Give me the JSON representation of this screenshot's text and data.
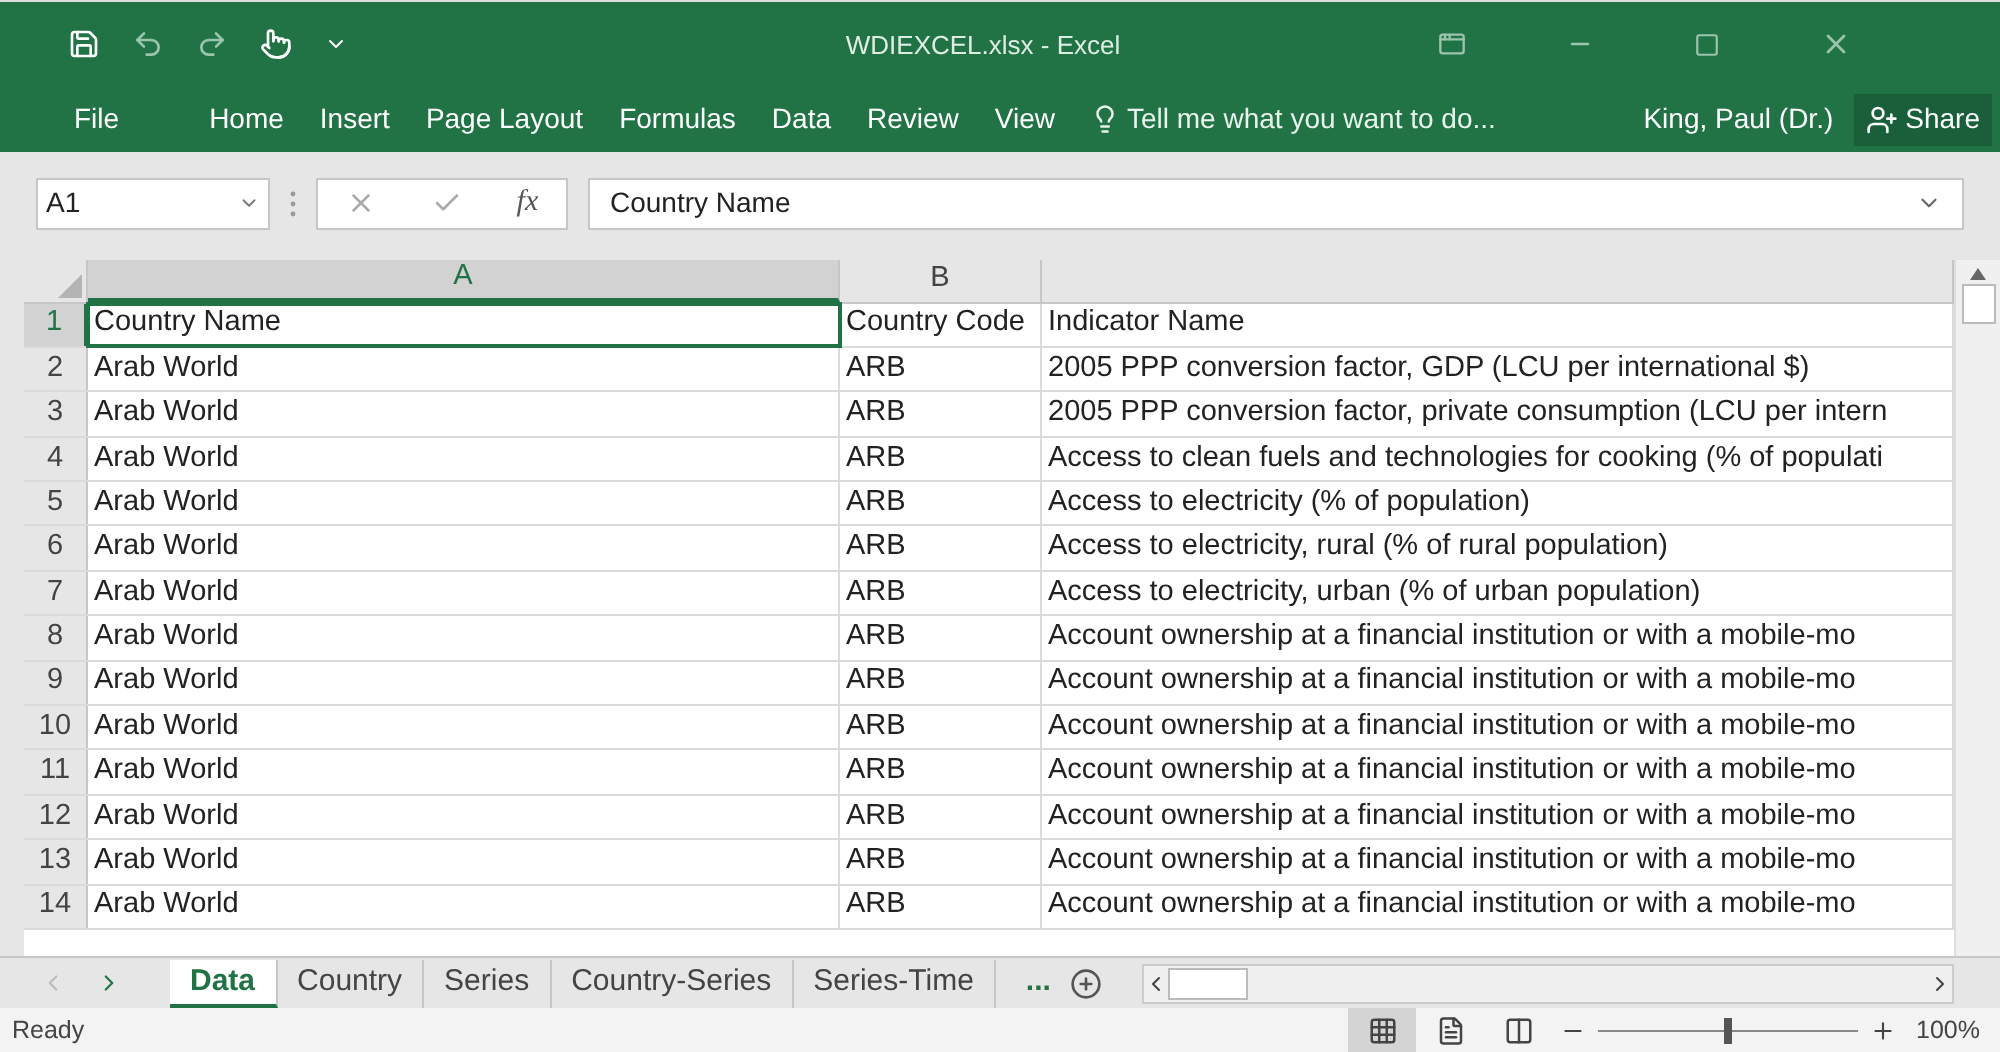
{
  "window": {
    "title": "WDIEXCEL.xlsx - Excel"
  },
  "ribbon_tabs": [
    {
      "label": "File"
    },
    {
      "label": "Home"
    },
    {
      "label": "Insert"
    },
    {
      "label": "Page Layout"
    },
    {
      "label": "Formulas"
    },
    {
      "label": "Data"
    },
    {
      "label": "Review"
    },
    {
      "label": "View"
    }
  ],
  "tell_me": {
    "placeholder": "Tell me what you want to do..."
  },
  "user": "King, Paul (Dr.)",
  "share": "Share",
  "formula_bar": {
    "name_box": "A1",
    "function_label": "fx",
    "value": "Country Name"
  },
  "columns": [
    {
      "label": "A",
      "selected": true
    },
    {
      "label": "B",
      "selected": false
    }
  ],
  "rows": [
    {
      "number": "1",
      "selected": true,
      "cells": [
        "Country Name",
        "Country Code",
        "Indicator Name"
      ]
    },
    {
      "number": "2",
      "selected": false,
      "cells": [
        "Arab World",
        "ARB",
        "2005 PPP conversion factor, GDP (LCU per international $)"
      ]
    },
    {
      "number": "3",
      "selected": false,
      "cells": [
        "Arab World",
        "ARB",
        "2005 PPP conversion factor, private consumption (LCU per intern"
      ]
    },
    {
      "number": "4",
      "selected": false,
      "cells": [
        "Arab World",
        "ARB",
        "Access to clean fuels and technologies for cooking (% of populati"
      ]
    },
    {
      "number": "5",
      "selected": false,
      "cells": [
        "Arab World",
        "ARB",
        "Access to electricity (% of population)"
      ]
    },
    {
      "number": "6",
      "selected": false,
      "cells": [
        "Arab World",
        "ARB",
        "Access to electricity, rural (% of rural population)"
      ]
    },
    {
      "number": "7",
      "selected": false,
      "cells": [
        "Arab World",
        "ARB",
        "Access to electricity, urban (% of urban population)"
      ]
    },
    {
      "number": "8",
      "selected": false,
      "cells": [
        "Arab World",
        "ARB",
        "Account ownership at a financial institution or with a mobile-mo"
      ]
    },
    {
      "number": "9",
      "selected": false,
      "cells": [
        "Arab World",
        "ARB",
        "Account ownership at a financial institution or with a mobile-mo"
      ]
    },
    {
      "number": "10",
      "selected": false,
      "cells": [
        "Arab World",
        "ARB",
        "Account ownership at a financial institution or with a mobile-mo"
      ]
    },
    {
      "number": "11",
      "selected": false,
      "cells": [
        "Arab World",
        "ARB",
        "Account ownership at a financial institution or with a mobile-mo"
      ]
    },
    {
      "number": "12",
      "selected": false,
      "cells": [
        "Arab World",
        "ARB",
        "Account ownership at a financial institution or with a mobile-mo"
      ]
    },
    {
      "number": "13",
      "selected": false,
      "cells": [
        "Arab World",
        "ARB",
        "Account ownership at a financial institution or with a mobile-mo"
      ]
    },
    {
      "number": "14",
      "selected": false,
      "cells": [
        "Arab World",
        "ARB",
        "Account ownership at a financial institution or with a mobile-mo"
      ]
    }
  ],
  "sheet_tabs": [
    {
      "label": "Data",
      "selected": true
    },
    {
      "label": "Country",
      "selected": false
    },
    {
      "label": "Series",
      "selected": false
    },
    {
      "label": "Country-Series",
      "selected": false
    },
    {
      "label": "Series-Time",
      "selected": false
    }
  ],
  "more_sheets": "...",
  "status_bar": {
    "text": "Ready",
    "views": [
      {
        "kind": "normal",
        "selected": true
      },
      {
        "kind": "page_layout",
        "selected": false
      },
      {
        "kind": "page_break",
        "selected": false
      }
    ],
    "zoom": {
      "level": 0.5,
      "reading": "100%"
    }
  }
}
